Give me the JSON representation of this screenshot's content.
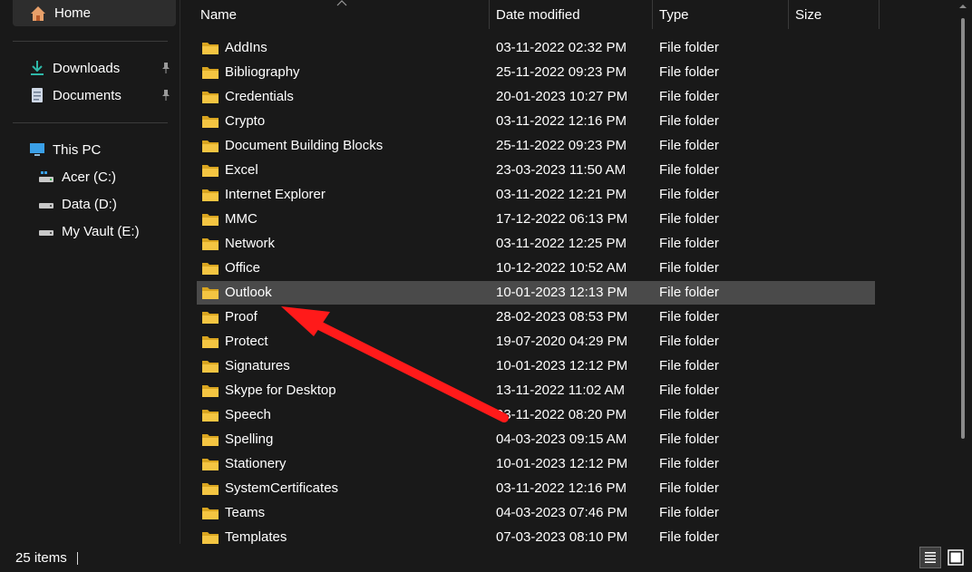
{
  "sidebar": {
    "home": "Home",
    "quick": [
      {
        "label": "Downloads"
      },
      {
        "label": "Documents"
      }
    ],
    "this_pc": "This PC",
    "drives": [
      {
        "label": "Acer (C:)"
      },
      {
        "label": "Data (D:)"
      },
      {
        "label": "My Vault (E:)"
      }
    ]
  },
  "columns": {
    "name": "Name",
    "date": "Date modified",
    "type": "Type",
    "size": "Size"
  },
  "files": [
    {
      "name": "AddIns",
      "date": "03-11-2022 02:32 PM",
      "type": "File folder"
    },
    {
      "name": "Bibliography",
      "date": "25-11-2022 09:23 PM",
      "type": "File folder"
    },
    {
      "name": "Credentials",
      "date": "20-01-2023 10:27 PM",
      "type": "File folder"
    },
    {
      "name": "Crypto",
      "date": "03-11-2022 12:16 PM",
      "type": "File folder"
    },
    {
      "name": "Document Building Blocks",
      "date": "25-11-2022 09:23 PM",
      "type": "File folder"
    },
    {
      "name": "Excel",
      "date": "23-03-2023 11:50 AM",
      "type": "File folder"
    },
    {
      "name": "Internet Explorer",
      "date": "03-11-2022 12:21 PM",
      "type": "File folder"
    },
    {
      "name": "MMC",
      "date": "17-12-2022 06:13 PM",
      "type": "File folder"
    },
    {
      "name": "Network",
      "date": "03-11-2022 12:25 PM",
      "type": "File folder"
    },
    {
      "name": "Office",
      "date": "10-12-2022 10:52 AM",
      "type": "File folder"
    },
    {
      "name": "Outlook",
      "date": "10-01-2023 12:13 PM",
      "type": "File folder"
    },
    {
      "name": "Proof",
      "date": "28-02-2023 08:53 PM",
      "type": "File folder"
    },
    {
      "name": "Protect",
      "date": "19-07-2020 04:29 PM",
      "type": "File folder"
    },
    {
      "name": "Signatures",
      "date": "10-01-2023 12:12 PM",
      "type": "File folder"
    },
    {
      "name": "Skype for Desktop",
      "date": "13-11-2022 11:02 AM",
      "type": "File folder"
    },
    {
      "name": "Speech",
      "date": "03-11-2022 08:20 PM",
      "type": "File folder"
    },
    {
      "name": "Spelling",
      "date": "04-03-2023 09:15 AM",
      "type": "File folder"
    },
    {
      "name": "Stationery",
      "date": "10-01-2023 12:12 PM",
      "type": "File folder"
    },
    {
      "name": "SystemCertificates",
      "date": "03-11-2022 12:16 PM",
      "type": "File folder"
    },
    {
      "name": "Teams",
      "date": "04-03-2023 07:46 PM",
      "type": "File folder"
    },
    {
      "name": "Templates",
      "date": "07-03-2023 08:10 PM",
      "type": "File folder"
    }
  ],
  "selected_file": "Outlook",
  "status": {
    "count": "25 items"
  },
  "icons": {
    "home": "home-icon",
    "downloads": "download-icon",
    "documents": "document-icon",
    "pin": "pin-icon",
    "pc": "monitor-icon",
    "drive": "drive-icon",
    "folder": "folder-icon",
    "details_view": "details-view-icon",
    "tiles_view": "large-icons-view-icon"
  },
  "colors": {
    "background": "#191919",
    "selected_row": "#4a4a4a",
    "folder": "#f4c542",
    "annotation_arrow": "#ff1a1a"
  }
}
